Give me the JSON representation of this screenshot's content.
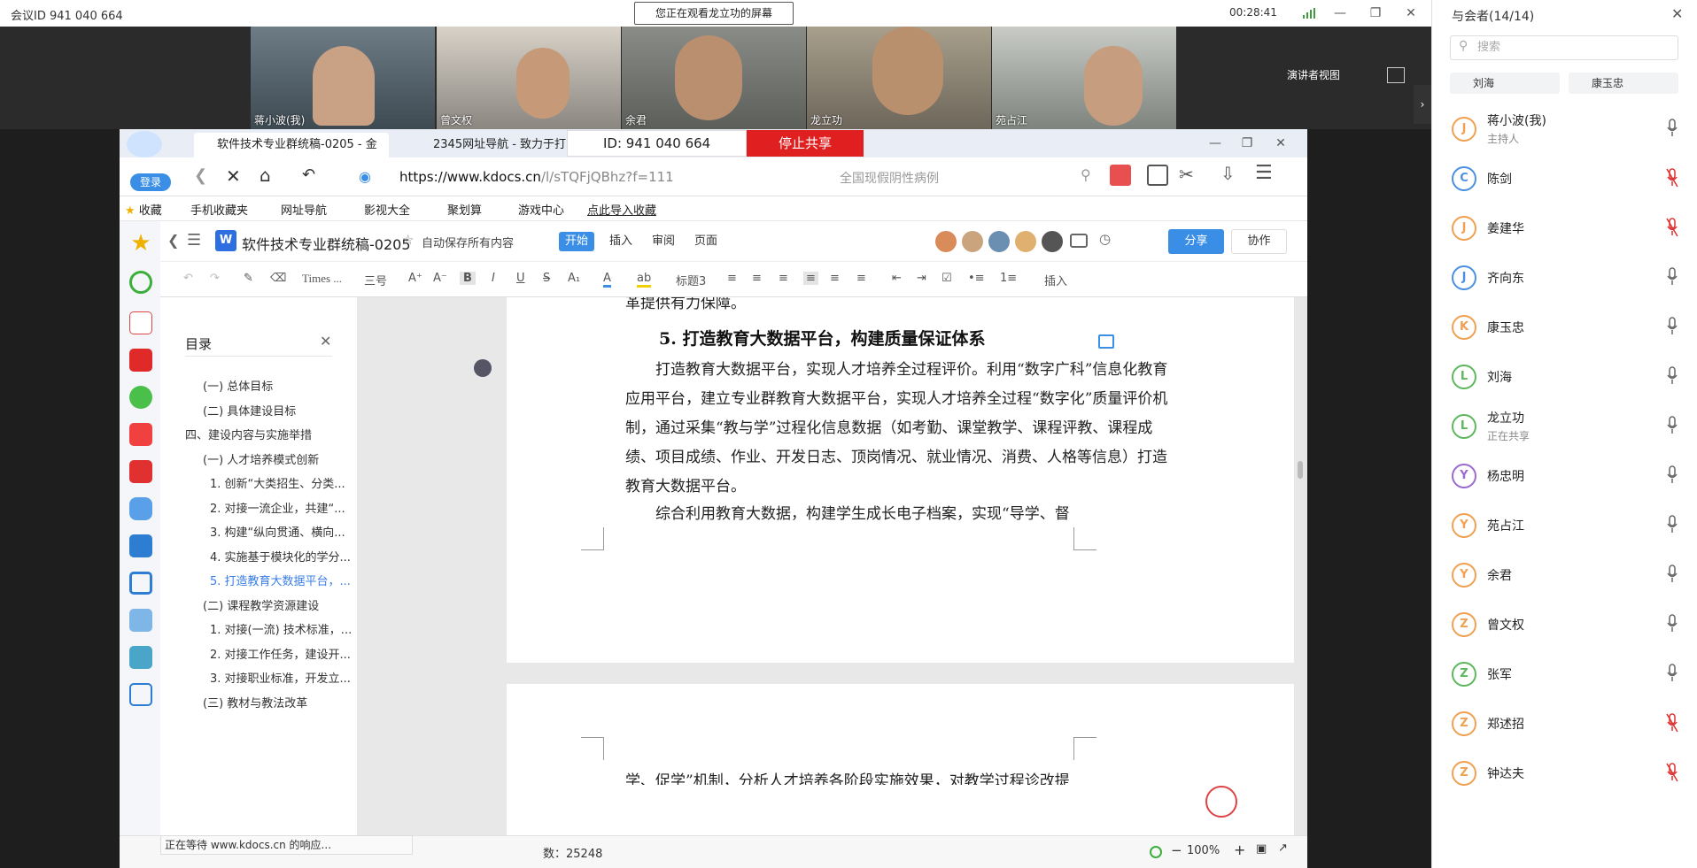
{
  "meeting": {
    "id_label": "会议ID 941 040 664",
    "watching_banner": "您正在观看龙立功的屏幕",
    "elapsed": "00:28:41",
    "presenter_view": "演讲者视图",
    "videos": [
      {
        "name": "蒋小波(我)"
      },
      {
        "name": "曾文权"
      },
      {
        "name": "余君"
      },
      {
        "name": "龙立功"
      },
      {
        "name": "苑占江"
      }
    ]
  },
  "share_control": {
    "id_label": "ID: 941 040 664",
    "stop_label": "停止共享"
  },
  "browser": {
    "tabs": [
      {
        "label": "软件技术专业群统稿-0205 - 金"
      },
      {
        "label": "2345网址导航 - 致力于打"
      }
    ],
    "login_label": "登录",
    "url_secure": "https://www.",
    "url_domain": "kdocs.cn",
    "url_path": "/l/sTQFjQBhz?f=111",
    "search_placeholder": "全国现假阴性病例",
    "favorites": [
      {
        "label": "收藏"
      },
      {
        "label": "手机收藏夹"
      },
      {
        "label": "网址导航"
      },
      {
        "label": "影视大全"
      },
      {
        "label": "聚划算"
      },
      {
        "label": "游戏中心"
      },
      {
        "label": "点此导入收藏"
      }
    ],
    "status_text": "正在等待 www.kdocs.cn 的响应..."
  },
  "doc": {
    "title": "软件技术专业群统稿-0205",
    "autosave": "自动保存所有内容",
    "tabs": [
      {
        "label": "开始",
        "active": true
      },
      {
        "label": "插入",
        "active": false
      },
      {
        "label": "审阅",
        "active": false
      },
      {
        "label": "页面",
        "active": false
      }
    ],
    "share_label": "分享",
    "collab_label": "协作",
    "toolbar": {
      "font": "Times ...",
      "size": "三号",
      "style": "标题3",
      "insert": "插入"
    },
    "outline_title": "目录",
    "outline": [
      {
        "label": "(一) 总体目标",
        "level": 2,
        "active": false
      },
      {
        "label": "(二) 具体建设目标",
        "level": 2,
        "active": false
      },
      {
        "label": "四、建设内容与实施举措",
        "level": 1,
        "active": false
      },
      {
        "label": "(一) 人才培养模式创新",
        "level": 2,
        "active": false
      },
      {
        "label": "1. 创新“大类招生、分类...",
        "level": 3,
        "active": false
      },
      {
        "label": "2. 对接一流企业，共建“...",
        "level": 3,
        "active": false
      },
      {
        "label": "3. 构建“纵向贯通、横向...",
        "level": 3,
        "active": false
      },
      {
        "label": "4. 实施基于模块化的学分...",
        "level": 3,
        "active": false
      },
      {
        "label": "5. 打造教育大数据平台，...",
        "level": 3,
        "active": true
      },
      {
        "label": "(二) 课程教学资源建设",
        "level": 2,
        "active": false
      },
      {
        "label": "1. 对接(一流) 技术标准，...",
        "level": 3,
        "active": false
      },
      {
        "label": "2. 对接工作任务，建设开...",
        "level": 3,
        "active": false
      },
      {
        "label": "3. 对接职业标准，开发立...",
        "level": 3,
        "active": false
      },
      {
        "label": "(三) 教材与教法改革",
        "level": 2,
        "active": false
      }
    ],
    "prev_line": "革提供有力保障。",
    "heading": "5. 打造教育大数据平台，构建质量保证体系",
    "para1": "打造教育大数据平台，实现人才培养全过程评价。利用“数字广科”信息化教育应用平台，建立专业群教育大数据平台，实现人才培养全过程“数字化”质量评价机制，通过采集“教与学”过程化信息数据（如考勤、课堂教学、课程评教、课程成绩、项目成绩、作业、开发日志、顶岗情况、就业情况、消费、人格等信息）打造教育大数据平台。",
    "para2": "综合利用教育大数据，构建学生成长电子档案，实现“导学、督",
    "para3": "学、促学”机制，分析人才培养各阶段实施效果，对教学过程诊改提",
    "word_count": "数：25248",
    "zoom": "100%"
  },
  "participants": {
    "title": "与会者(14/14)",
    "search_placeholder": "搜索",
    "chips": [
      {
        "label": "刘海"
      },
      {
        "label": "康玉忠"
      }
    ],
    "list": [
      {
        "initial": "J",
        "name": "蒋小波(我)",
        "role": "主持人",
        "color": "#f0a050",
        "muted": false
      },
      {
        "initial": "C",
        "name": "陈剑",
        "role": "",
        "color": "#4a90e2",
        "muted": true
      },
      {
        "initial": "J",
        "name": "姜建华",
        "role": "",
        "color": "#f0a050",
        "muted": true
      },
      {
        "initial": "J",
        "name": "齐向东",
        "role": "",
        "color": "#4a90e2",
        "muted": false
      },
      {
        "initial": "K",
        "name": "康玉忠",
        "role": "",
        "color": "#f0a050",
        "muted": false
      },
      {
        "initial": "L",
        "name": "刘海",
        "role": "",
        "color": "#5cb85c",
        "muted": false
      },
      {
        "initial": "L",
        "name": "龙立功",
        "role": "正在共享",
        "color": "#5cb85c",
        "muted": false
      },
      {
        "initial": "Y",
        "name": "杨忠明",
        "role": "",
        "color": "#9b6ad0",
        "muted": false
      },
      {
        "initial": "Y",
        "name": "苑占江",
        "role": "",
        "color": "#f0a050",
        "muted": false
      },
      {
        "initial": "Y",
        "name": "余君",
        "role": "",
        "color": "#f0a050",
        "muted": false
      },
      {
        "initial": "Z",
        "name": "曾文权",
        "role": "",
        "color": "#f0a050",
        "muted": false
      },
      {
        "initial": "Z",
        "name": "张军",
        "role": "",
        "color": "#5cb85c",
        "muted": false
      },
      {
        "initial": "Z",
        "name": "郑述招",
        "role": "",
        "color": "#f0a050",
        "muted": true
      },
      {
        "initial": "Z",
        "name": "钟达夫",
        "role": "",
        "color": "#f0a050",
        "muted": true
      }
    ]
  }
}
